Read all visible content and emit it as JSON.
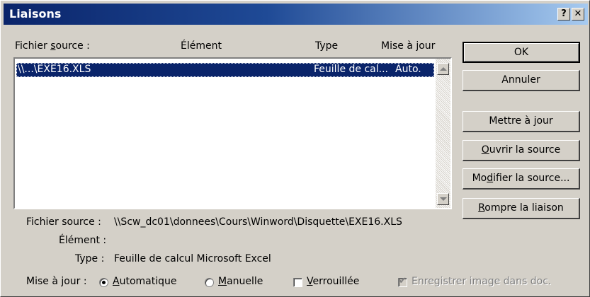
{
  "window": {
    "title": "Liaisons",
    "help_label": "?",
    "close_label": "✕"
  },
  "columns": {
    "source_prefix": "Fichier ",
    "source_access": "s",
    "source_suffix": "ource :",
    "element": "Élément",
    "type": "Type",
    "update": "Mise à jour"
  },
  "links": [
    {
      "source": "\\\\...\\EXE16.XLS",
      "element": "",
      "type": "Feuille de cal...",
      "update": "Auto."
    }
  ],
  "buttons": {
    "ok": "OK",
    "cancel": "Annuler",
    "update_now_prefix": "Mettre à ",
    "update_now_access": "j",
    "update_now_suffix": "our",
    "open_source_access": "O",
    "open_source_suffix": "uvrir la source",
    "change_source_prefix": "Mo",
    "change_source_access": "d",
    "change_source_suffix": "ifier la source...",
    "break_link_access": "R",
    "break_link_suffix": "ompre la liaison"
  },
  "details": {
    "source_label": "Fichier source :",
    "source_value": "\\\\Scw_dc01\\donnees\\Cours\\Winword\\Disquette\\EXE16.XLS",
    "element_label": "Élément :",
    "element_value": "",
    "type_label": "Type :",
    "type_value": "Feuille de calcul Microsoft Excel"
  },
  "update_options": {
    "label": "Mise à jour :",
    "automatic_access": "A",
    "automatic_suffix": "utomatique",
    "automatic_selected": true,
    "manual_access": "M",
    "manual_suffix": "anuelle",
    "manual_selected": false,
    "locked_access": "V",
    "locked_suffix": "errouillée",
    "locked_checked": false,
    "save_image_label": "Enregistrer image dans doc.",
    "save_image_checked": true,
    "save_image_enabled": false
  }
}
